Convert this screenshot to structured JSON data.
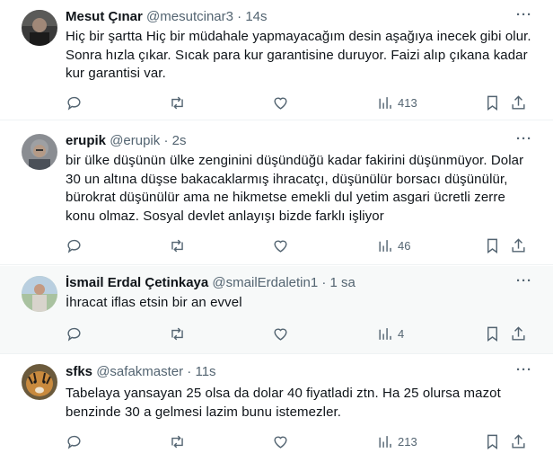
{
  "tweets": [
    {
      "name": "Mesut Çınar",
      "handle": "@mesutcinar3",
      "sep": "·",
      "time": "14s",
      "text": "Hiç  bir şartta Hiç bir müdahale yapmayacağım desin aşağıya inecek gibi olur. Sonra hızla çıkar. Sıcak para kur garantisine duruyor. Faizi alıp çıkana kadar kur garantisi var.",
      "views": "413",
      "more": "···"
    },
    {
      "name": "erupik",
      "handle": "@erupik",
      "sep": "·",
      "time": "2s",
      "text": "bir ülke düşünün ülke zenginini düşündüğü kadar fakirini düşünmüyor. Dolar 30 un altına düşse bakacaklarmış ihracatçı, düşünülür borsacı düşünülür, bürokrat düşünülür ama ne hikmetse emekli dul yetim asgari ücretli zerre konu olmaz. Sosyal devlet anlayışı bizde farklı işliyor",
      "views": "46",
      "more": "···"
    },
    {
      "name": "İsmail Erdal Çetinkaya",
      "handle": "@smailErdaletin1",
      "sep": "·",
      "time": "1 sa",
      "text": "İhracat iflas etsin bir an evvel",
      "views": "4",
      "more": "···"
    },
    {
      "name": "sfks",
      "handle": "@safakmaster",
      "sep": "·",
      "time": "11s",
      "text": "Tabelaya yansayan 25 olsa da dolar 40 fiyatladi ztn.  Ha 25 olursa mazot benzinde 30 a gelmesi lazim bunu istemezler.",
      "views": "213",
      "more": "···"
    }
  ]
}
